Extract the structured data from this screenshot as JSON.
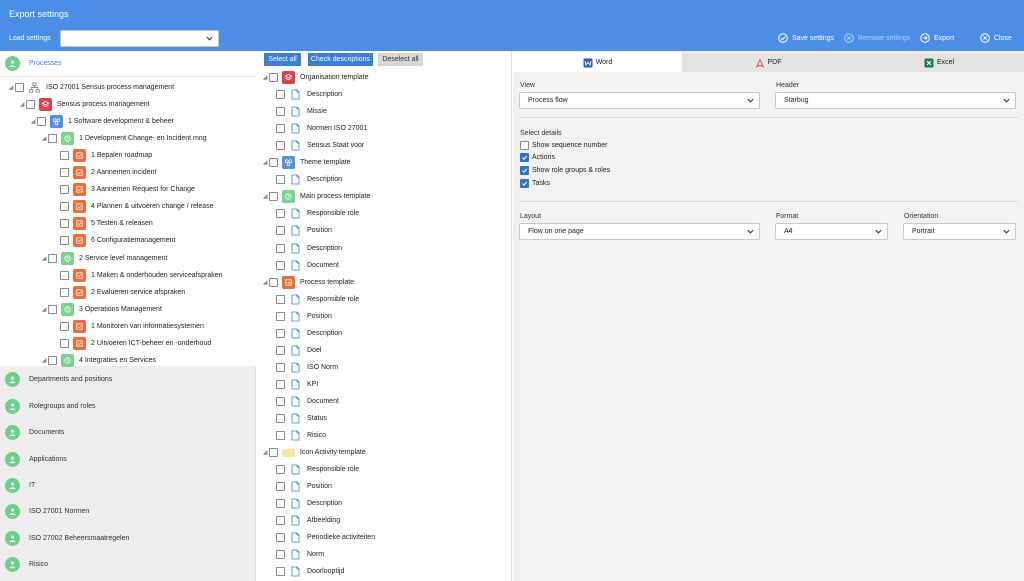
{
  "header": {
    "title": "Export settings",
    "load_label": "Load settings",
    "load_value": "",
    "save": "Save settings",
    "remove": "Remove settings",
    "export": "Export",
    "close": "Close"
  },
  "sections": [
    {
      "label": "Processes",
      "icon": "processes-icon",
      "active": true
    },
    {
      "label": "Departments and positions",
      "icon": "department-icon"
    },
    {
      "label": "Rolegroups and roles",
      "icon": "roles-icon"
    },
    {
      "label": "Documents",
      "icon": "document-icon"
    },
    {
      "label": "Applications",
      "icon": "application-icon"
    },
    {
      "label": "IT",
      "icon": "it-icon"
    },
    {
      "label": "ISO 27001 Normen",
      "icon": "warning-icon"
    },
    {
      "label": "ISO 27002 Beheersmaatregelen",
      "icon": "warning-icon"
    },
    {
      "label": "Risico",
      "icon": "warning-icon"
    }
  ],
  "tree": [
    {
      "label": "ISO 27001 Sensus process management",
      "level": 0,
      "icon": "hierarchy"
    },
    {
      "label": "Sensus process management",
      "level": 1,
      "icon": "red"
    },
    {
      "label": "1 Software development & beheer",
      "level": 2,
      "icon": "blue"
    },
    {
      "label": "1 Development Change- en Incident mng",
      "level": 3,
      "icon": "green"
    },
    {
      "label": "1 Bepalen roadmap",
      "level": 4,
      "icon": "orange"
    },
    {
      "label": "2 Aannemen incident",
      "level": 4,
      "icon": "orange"
    },
    {
      "label": "3 Aannemen Request for Change",
      "level": 4,
      "icon": "orange"
    },
    {
      "label": "4 Plannen & uitvoeren change / release",
      "level": 4,
      "icon": "orange"
    },
    {
      "label": "5 Testen & releasen",
      "level": 4,
      "icon": "orange"
    },
    {
      "label": "6 Configuratiemanagement",
      "level": 4,
      "icon": "orange"
    },
    {
      "label": "2 Service level management",
      "level": 3,
      "icon": "green"
    },
    {
      "label": "1 Maken & onderhouden serviceafspraken",
      "level": 4,
      "icon": "orange"
    },
    {
      "label": "2 Evalueren service afspraken",
      "level": 4,
      "icon": "orange"
    },
    {
      "label": "3 Operations Management",
      "level": 3,
      "icon": "green"
    },
    {
      "label": "1 Monitoren van informatiesystemen",
      "level": 4,
      "icon": "orange"
    },
    {
      "label": "2 Uitvoeren ICT-beheer en -onderhoud",
      "level": 4,
      "icon": "orange"
    },
    {
      "label": "4 Integraties en Services",
      "level": 3,
      "icon": "green"
    }
  ],
  "middle": {
    "select_all": "Select all",
    "check_descriptions": "Check descriptions",
    "deselect_all": "Deselect all"
  },
  "templates": [
    {
      "label": "Organisation template",
      "icon": "red",
      "fields": [
        "Description",
        "Missie",
        "Normen ISO 27001",
        "Sensus Staat voor"
      ]
    },
    {
      "label": "Theme template",
      "icon": "blue",
      "fields": [
        "Description"
      ]
    },
    {
      "label": "Main process template",
      "icon": "green",
      "fields": [
        "Responsible role",
        "Position",
        "Description",
        "Document"
      ]
    },
    {
      "label": "Process template",
      "icon": "orange",
      "fields": [
        "Responsible role",
        "Position",
        "Description",
        "Doel",
        "ISO Norm",
        "KPI",
        "Document",
        "Status",
        "Risico"
      ]
    },
    {
      "label": "Icon Activity template",
      "icon": "yellow",
      "fields": [
        "Responsible role",
        "Position",
        "Description",
        "Afbeelding",
        "Periodieke activiteiten",
        "Norm",
        "Doorlooptijd"
      ]
    }
  ],
  "tabs": [
    {
      "label": "Word",
      "icon": "word-icon",
      "active": true
    },
    {
      "label": "PDF",
      "icon": "pdf-icon"
    },
    {
      "label": "Excel",
      "icon": "excel-icon"
    }
  ],
  "settings": {
    "view_label": "View",
    "view_value": "Process flow",
    "header_label": "Header",
    "header_value": "Starbug",
    "details_label": "Select details",
    "details": [
      {
        "label": "Show sequence number",
        "checked": false
      },
      {
        "label": "Actions",
        "checked": true
      },
      {
        "label": "Show role groups & roles",
        "checked": true
      },
      {
        "label": "Tasks",
        "checked": true
      }
    ],
    "layout_label": "Layout",
    "layout_value": "Flow on one page",
    "format_label": "Format",
    "format_value": "A4",
    "orientation_label": "Orientation",
    "orientation_value": "Portrait"
  },
  "colors": {
    "header": "#4a8ee6",
    "accent": "#3b7ed6",
    "green": "#6fcf8c",
    "red": "#d9414c",
    "orange": "#e86e3a"
  }
}
